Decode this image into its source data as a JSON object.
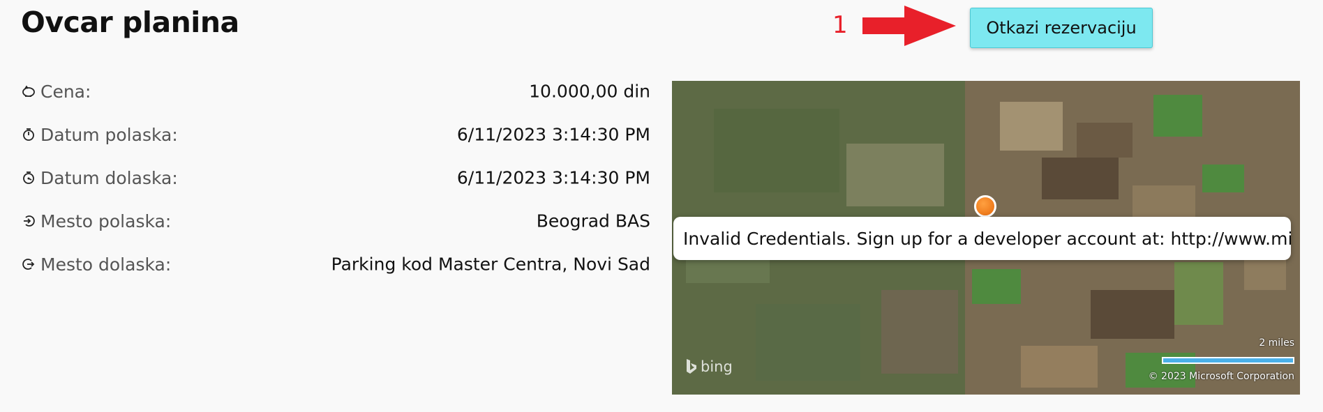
{
  "trip": {
    "title": "Ovcar planina"
  },
  "annotation": {
    "number": "1",
    "color": "#e8202a"
  },
  "actions": {
    "cancel_label": "Otkazi rezervaciju"
  },
  "details": [
    {
      "icon": "piggy-bank-icon",
      "label": "Cena:",
      "value": "10.000,00 din"
    },
    {
      "icon": "stopwatch-icon",
      "label": "Datum polaska:",
      "value": "6/11/2023 3:14:30 PM"
    },
    {
      "icon": "timer-icon",
      "label": "Datum dolaska:",
      "value": "6/11/2023 3:14:30 PM"
    },
    {
      "icon": "departure-icon",
      "label": "Mesto polaska:",
      "value": "Beograd BAS"
    },
    {
      "icon": "arrival-icon",
      "label": "Mesto dolaska:",
      "value": "Parking kod Master Centra, Novi Sad"
    }
  ],
  "map": {
    "error_message": "Invalid Credentials. Sign up for a developer account at: http://www.microsoft.com/maps/developers",
    "brand": "bing",
    "scale_label": "2 miles",
    "copyright": "© 2023 Microsoft Corporation",
    "pin_color": "#e86a0c",
    "scale_color": "#4ab0e8"
  }
}
